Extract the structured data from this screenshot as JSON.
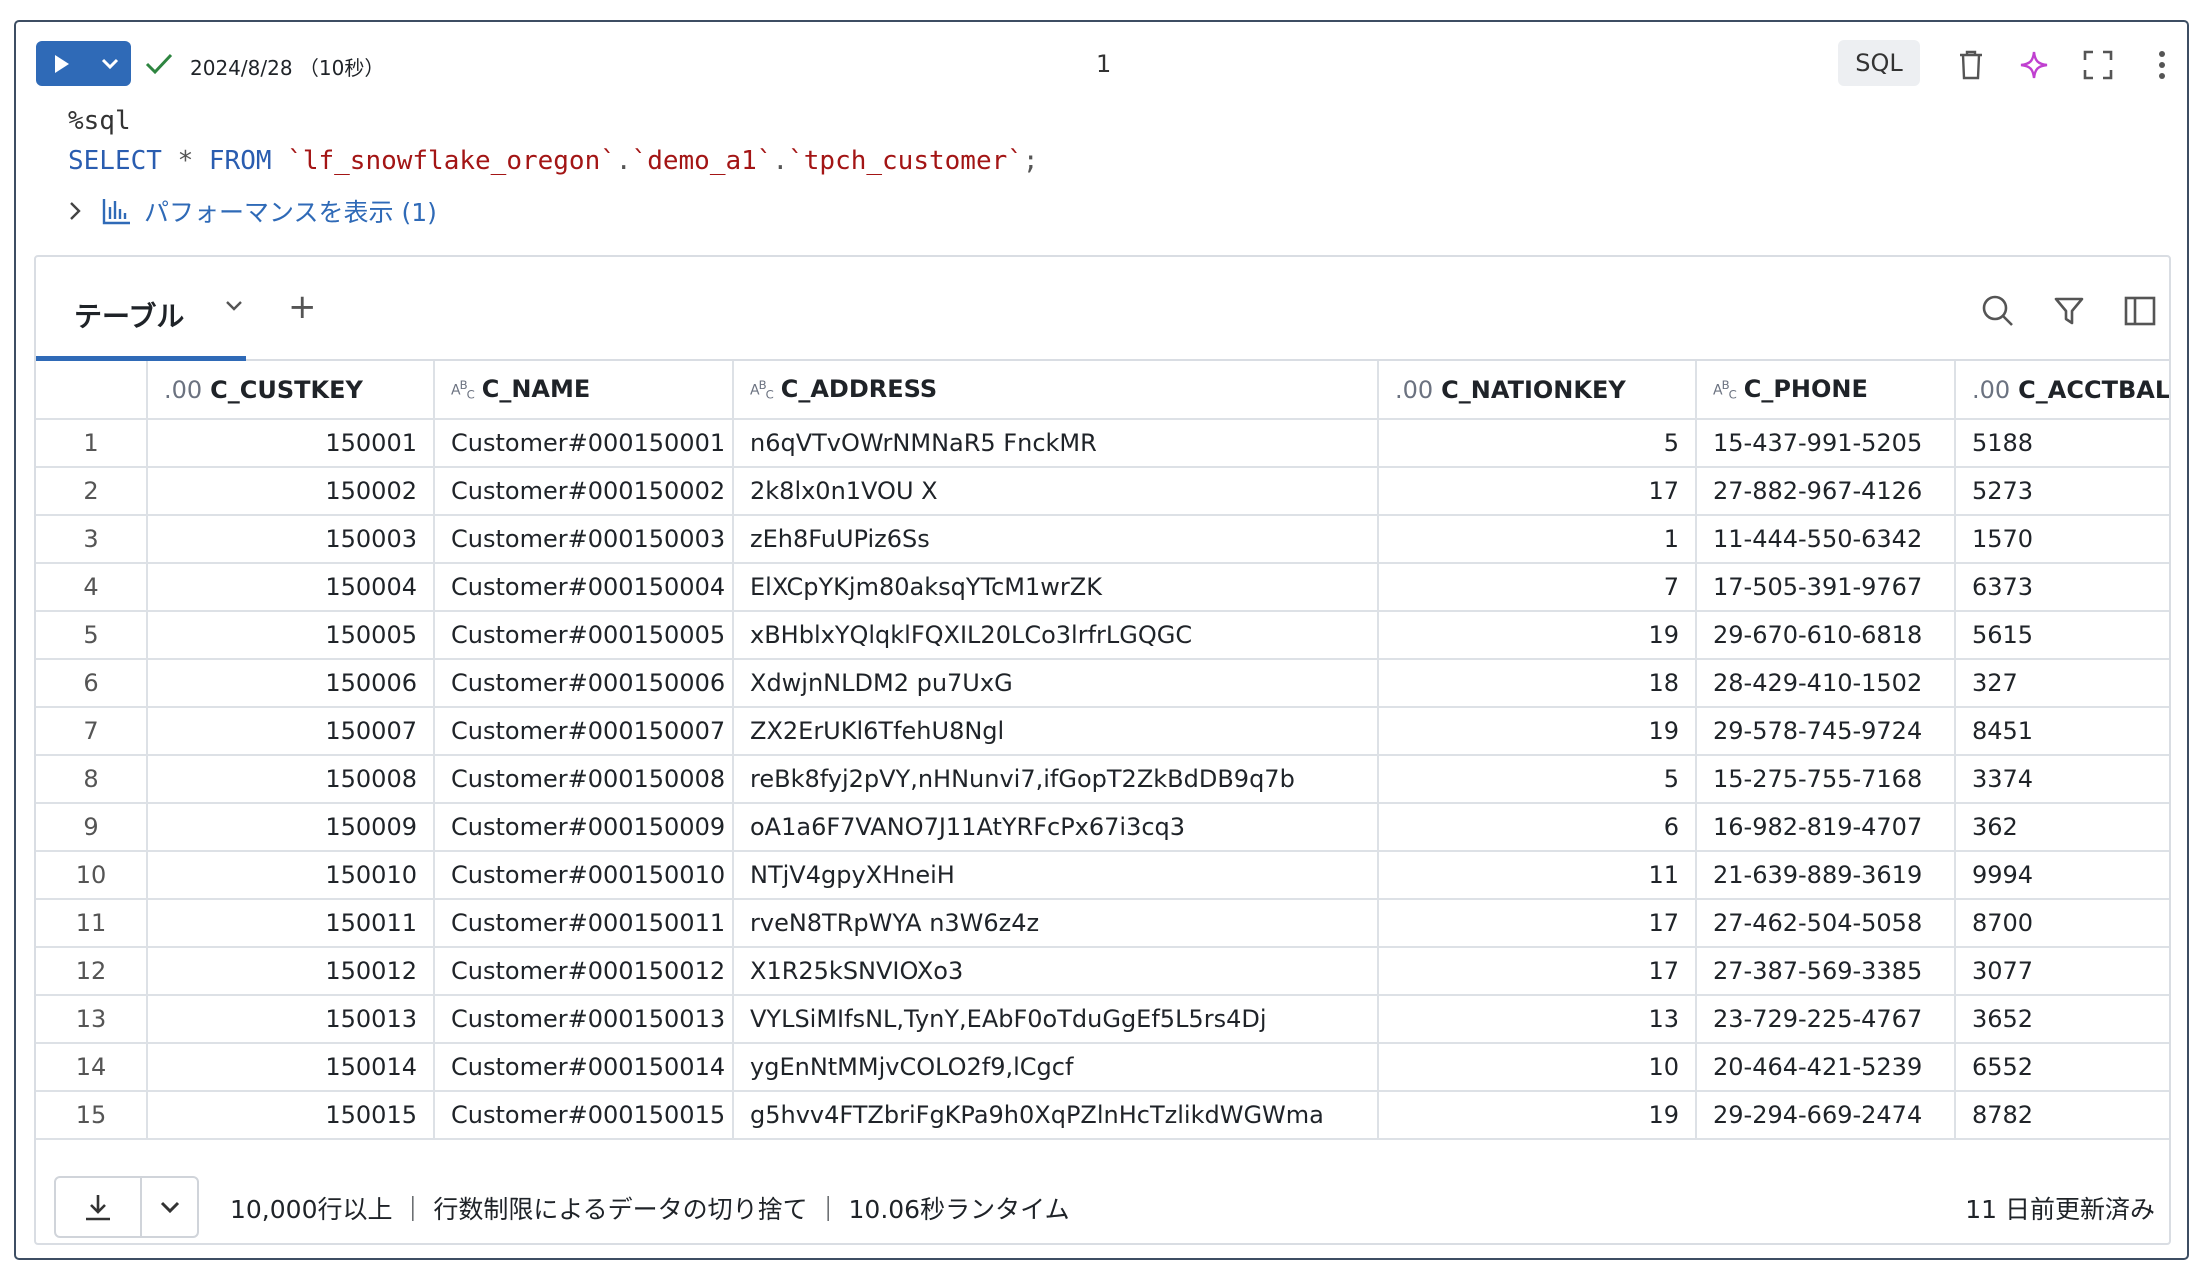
{
  "header": {
    "status": "2024/8/28 （10秒）",
    "cell_number": "1",
    "language_badge": "SQL"
  },
  "code": {
    "line1": "%sql",
    "keyword_select": "SELECT",
    "star": " * ",
    "keyword_from": "FROM",
    "catalog": "`lf_snowflake_oregon`",
    "schema": "`demo_a1`",
    "table": "`tpch_customer`",
    "dot": ".",
    "terminator": ";"
  },
  "performance_link": "パフォーマンスを表示 (1)",
  "results": {
    "tab_label": "テーブル",
    "add_label": "+",
    "columns": [
      {
        "type": ".00",
        "name": "C_CUSTKEY"
      },
      {
        "type": "abc",
        "name": "C_NAME"
      },
      {
        "type": "abc",
        "name": "C_ADDRESS"
      },
      {
        "type": ".00",
        "name": "C_NATIONKEY"
      },
      {
        "type": "abc",
        "name": "C_PHONE"
      },
      {
        "type": ".00",
        "name": "C_ACCTBAL"
      }
    ],
    "rows": [
      [
        "1",
        "150001",
        "Customer#000150001",
        "n6qVTvOWrNMNaR5 FnckMR",
        "5",
        "15-437-991-5205",
        "5188"
      ],
      [
        "2",
        "150002",
        "Customer#000150002",
        "2k8lx0n1VOU X",
        "17",
        "27-882-967-4126",
        "5273"
      ],
      [
        "3",
        "150003",
        "Customer#000150003",
        "zEh8FuUPiz6Ss",
        "1",
        "11-444-550-6342",
        "1570"
      ],
      [
        "4",
        "150004",
        "Customer#000150004",
        "ElXCpYKjm80aksqYTcM1wrZK",
        "7",
        "17-505-391-9767",
        "6373"
      ],
      [
        "5",
        "150005",
        "Customer#000150005",
        "xBHblxYQlqklFQXIL20LCo3lrfrLGQGC",
        "19",
        "29-670-610-6818",
        "5615"
      ],
      [
        "6",
        "150006",
        "Customer#000150006",
        "XdwjnNLDM2 pu7UxG",
        "18",
        "28-429-410-1502",
        "327"
      ],
      [
        "7",
        "150007",
        "Customer#000150007",
        "ZX2ErUKl6TfehU8Ngl",
        "19",
        "29-578-745-9724",
        "8451"
      ],
      [
        "8",
        "150008",
        "Customer#000150008",
        "reBk8fyj2pVY,nHNunvi7,ifGopT2ZkBdDB9q7b",
        "5",
        "15-275-755-7168",
        "3374"
      ],
      [
        "9",
        "150009",
        "Customer#000150009",
        "oA1a6F7VANO7J11AtYRFcPx67i3cq3",
        "6",
        "16-982-819-4707",
        "362"
      ],
      [
        "10",
        "150010",
        "Customer#000150010",
        "NTjV4gpyXHneiH",
        "11",
        "21-639-889-3619",
        "9994"
      ],
      [
        "11",
        "150011",
        "Customer#000150011",
        "rveN8TRpWYA n3W6z4z",
        "17",
        "27-462-504-5058",
        "8700"
      ],
      [
        "12",
        "150012",
        "Customer#000150012",
        "X1R25kSNVIOXo3",
        "17",
        "27-387-569-3385",
        "3077"
      ],
      [
        "13",
        "150013",
        "Customer#000150013",
        "VYLSiMIfsNL,TynY,EAbF0oTduGgEf5L5rs4Dj",
        "13",
        "23-729-225-4767",
        "3652"
      ],
      [
        "14",
        "150014",
        "Customer#000150014",
        "ygEnNtMMjvCOLO2f9,lCgcf",
        "10",
        "20-464-421-5239",
        "6552"
      ],
      [
        "15",
        "150015",
        "Customer#000150015",
        "g5hvv4FTZbriFgKPa9h0XqPZlnHcTzlikdWGWma",
        "19",
        "29-294-669-2474",
        "8782"
      ]
    ],
    "footer_info": "10,000行以上 ｜ 行数制限によるデータの切り捨て ｜ 10.06秒ランタイム",
    "footer_updated": "11 日前更新済み"
  },
  "colors": {
    "accent": "#2f6ab7",
    "check": "#2e8540",
    "ai_sparkle": "#c040d0",
    "string": "#a31515"
  }
}
